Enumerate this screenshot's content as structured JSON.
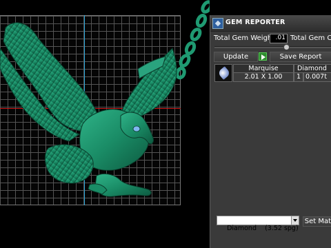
{
  "panel": {
    "title": "GEM REPORTER",
    "icon": "gem-reporter-icon",
    "total_weight_label": "Total Gem Weight",
    "total_weight_value": ".01",
    "total_count_label": "Total Gem Co",
    "update_label": "Update",
    "save_report_label": "Save Report",
    "table": {
      "headers": [
        "Marquise",
        "Diamond"
      ],
      "rows": [
        {
          "size": "2.01 X 1.00",
          "qty": "1",
          "weight": "0.007t"
        }
      ]
    },
    "material_select": "Diamond    (3.52 spg)",
    "set_material_label": "Set Mate"
  },
  "colors": {
    "model": "#1c8a66",
    "axis_vertical": "#2aa6d9",
    "axis_horizontal": "#d01818",
    "panel_bg": "#3a3a3a",
    "play_icon": "#2e8b2e"
  }
}
